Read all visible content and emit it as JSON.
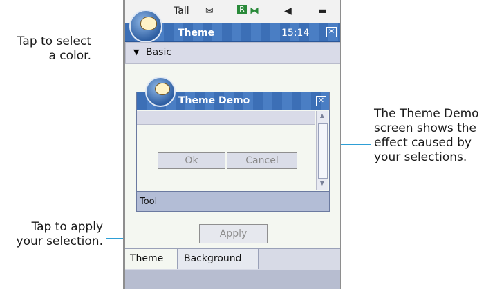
{
  "status_bar": {
    "signal_icon": "Tall",
    "message_icon": "✉",
    "roaming_badge": "R",
    "bluetooth_icon": "⧓",
    "volume_icon": "◀",
    "battery_icon": "▬"
  },
  "titlebar": {
    "title": "Theme",
    "time": "15:14",
    "close": "✕"
  },
  "dropdown": {
    "value": "Basic",
    "arrow": "▼"
  },
  "demo": {
    "title": "Theme Demo",
    "close": "✕",
    "ok_label": "Ok",
    "cancel_label": "Cancel",
    "toolbar_label": "Tool"
  },
  "apply_label": "Apply",
  "tabs": [
    {
      "label": "Theme"
    },
    {
      "label": "Background"
    }
  ],
  "callouts": {
    "color": [
      "Tap to select",
      "a color."
    ],
    "demo": [
      "The Theme Demo",
      "screen shows the",
      "effect caused by",
      "your selections."
    ],
    "apply": [
      "Tap to apply",
      "your selection."
    ]
  },
  "colors": {
    "accent": "#2e9fd6",
    "titlebar": "#3c6fb6"
  }
}
